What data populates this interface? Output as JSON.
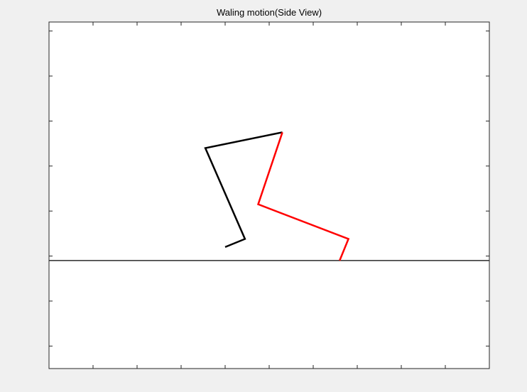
{
  "window": {
    "background_color": "#f0f0f0"
  },
  "chart_data": {
    "type": "line",
    "title": "Waling motion(Side View)",
    "xlabel": "",
    "ylabel": "",
    "xlim": [
      0,
      10
    ],
    "ylim": [
      -2.5,
      5.2
    ],
    "x_ticks": [
      1,
      2,
      3,
      4,
      5,
      6,
      7,
      8,
      9
    ],
    "y_ticks": [
      -2,
      -1,
      0,
      1,
      2,
      3,
      4,
      5
    ],
    "tick_labels_shown": false,
    "grid": false,
    "legend": "none",
    "axes_background": "#ffffff",
    "ground_line": {
      "y": -0.1,
      "color": "#000000"
    },
    "series": [
      {
        "color": "#000000",
        "x": [
          4.0,
          4.45,
          3.55,
          5.3
        ],
        "y": [
          0.2,
          0.38,
          2.4,
          2.75
        ]
      },
      {
        "color": "#ff0000",
        "x": [
          5.3,
          4.75,
          6.8,
          6.6
        ],
        "y": [
          2.75,
          1.15,
          0.38,
          -0.1
        ]
      }
    ]
  }
}
